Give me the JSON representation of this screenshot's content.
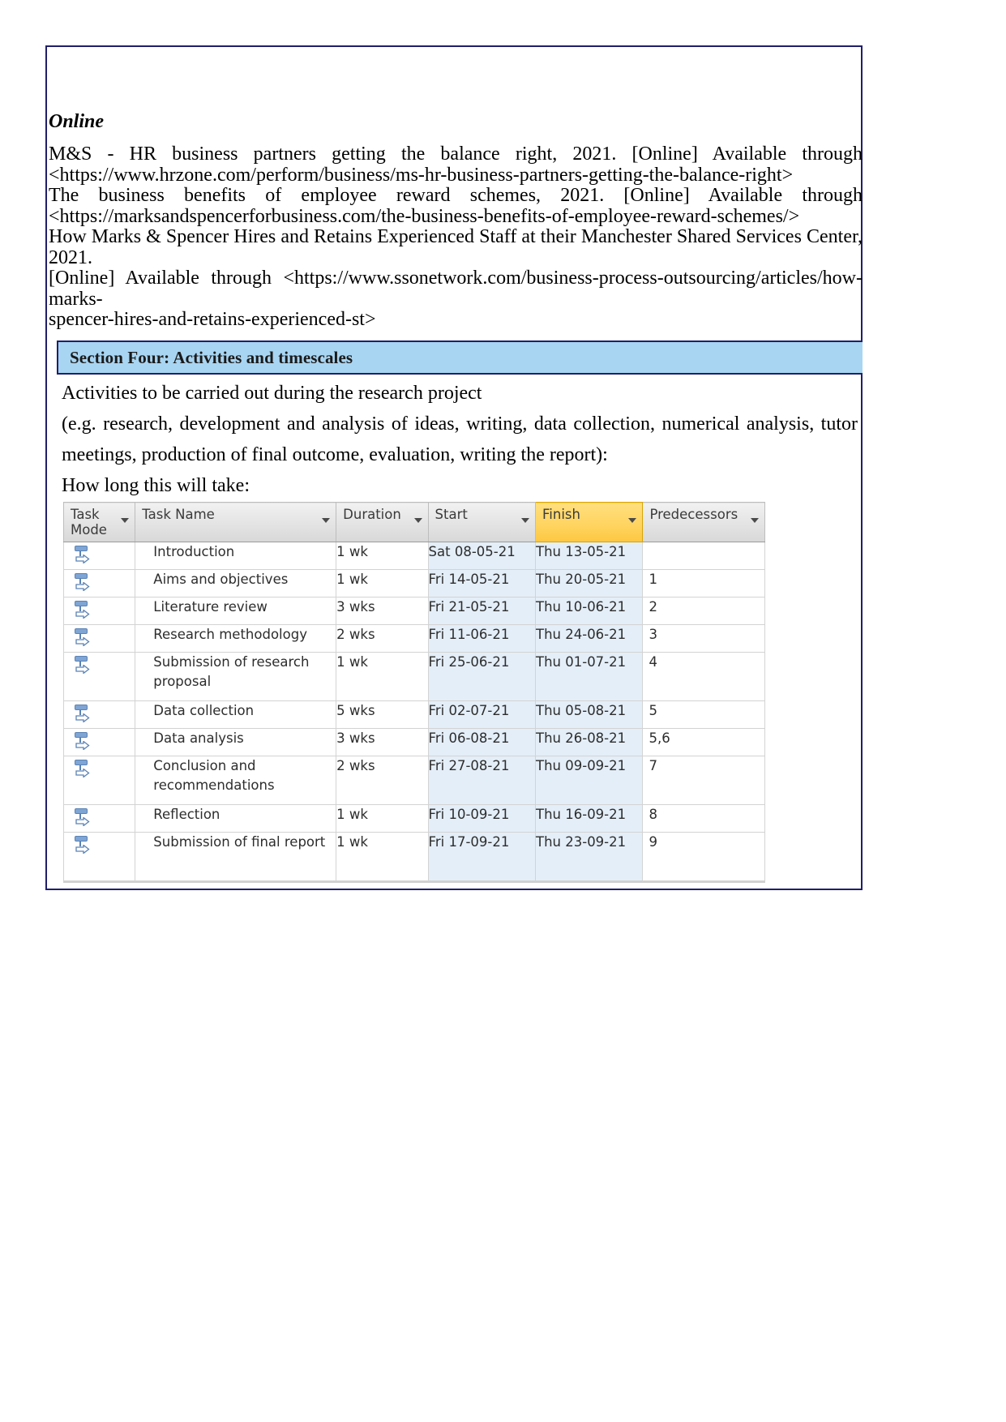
{
  "document": {
    "references": {
      "heading": "Online",
      "entries": [
        {
          "citation": "M&S - HR business partners getting the balance right, 2021. [Online] Available through",
          "url": "<https://www.hrzone.com/perform/business/ms-hr-business-partners-getting-the-balance-right>"
        },
        {
          "citation": "The business benefits of employee reward schemes, 2021. [Online] Available through",
          "url": "<https://marksandspencerforbusiness.com/the-business-benefits-of-employee-reward-schemes/>"
        },
        {
          "citation_line1": "How Marks & Spencer Hires and Retains Experienced Staff at their Manchester Shared Services Center, 2021.",
          "citation_line2": "[Online] Available through <https://www.ssonetwork.com/business-process-outsourcing/articles/how-marks-",
          "citation_line3": "spencer-hires-and-retains-experienced-st>"
        }
      ]
    },
    "section_four": {
      "band_title": "Section Four: Activities and timescales",
      "band_color": "#a8d5f2",
      "line1": "Activities to be carried out during the research project",
      "line2": "(e.g. research, development and analysis of ideas, writing, data collection, numerical analysis, tutor",
      "line3": "meetings, production of final outcome, evaluation, writing the report):",
      "line4": "How long this will take:"
    },
    "project_table": {
      "columns": [
        {
          "id": "task_mode",
          "label": "Task Mode",
          "label_line1": "Task",
          "label_line2": "Mode",
          "highlighted": false
        },
        {
          "id": "task_name",
          "label": "Task Name",
          "highlighted": false
        },
        {
          "id": "duration",
          "label": "Duration",
          "highlighted": false
        },
        {
          "id": "start",
          "label": "Start",
          "highlighted": false
        },
        {
          "id": "finish",
          "label": "Finish",
          "highlighted": true
        },
        {
          "id": "predecessors",
          "label": "Predecessors",
          "highlighted": false
        }
      ],
      "highlight_color": "#ffd35e",
      "date_cell_color": "#e4eef8",
      "mode_icon_name": "auto-scheduled-task-icon",
      "rows": [
        {
          "mode_icon": "auto-scheduled-task-icon",
          "name": "Introduction",
          "duration": "1 wk",
          "start": "Sat 08-05-21",
          "finish": "Thu 13-05-21",
          "predecessors": ""
        },
        {
          "mode_icon": "auto-scheduled-task-icon",
          "name": "Aims and objectives",
          "duration": "1 wk",
          "start": "Fri 14-05-21",
          "finish": "Thu 20-05-21",
          "predecessors": "1"
        },
        {
          "mode_icon": "auto-scheduled-task-icon",
          "name": "Literature review",
          "duration": "3 wks",
          "start": "Fri 21-05-21",
          "finish": "Thu 10-06-21",
          "predecessors": "2"
        },
        {
          "mode_icon": "auto-scheduled-task-icon",
          "name": "Research methodology",
          "duration": "2 wks",
          "start": "Fri 11-06-21",
          "finish": "Thu 24-06-21",
          "predecessors": "3"
        },
        {
          "mode_icon": "auto-scheduled-task-icon",
          "name": "Submission of research proposal",
          "duration": "1 wk",
          "start": "Fri 25-06-21",
          "finish": "Thu 01-07-21",
          "predecessors": "4"
        },
        {
          "mode_icon": "auto-scheduled-task-icon",
          "name": "Data collection",
          "duration": "5 wks",
          "start": "Fri 02-07-21",
          "finish": "Thu 05-08-21",
          "predecessors": "5"
        },
        {
          "mode_icon": "auto-scheduled-task-icon",
          "name": "Data analysis",
          "duration": "3 wks",
          "start": "Fri 06-08-21",
          "finish": "Thu 26-08-21",
          "predecessors": "5,6"
        },
        {
          "mode_icon": "auto-scheduled-task-icon",
          "name": "Conclusion and recommendations",
          "duration": "2 wks",
          "start": "Fri 27-08-21",
          "finish": "Thu 09-09-21",
          "predecessors": "7"
        },
        {
          "mode_icon": "auto-scheduled-task-icon",
          "name": "Reflection",
          "duration": "1 wk",
          "start": "Fri 10-09-21",
          "finish": "Thu 16-09-21",
          "predecessors": "8"
        },
        {
          "mode_icon": "auto-scheduled-task-icon",
          "name": "Submission of final report",
          "duration": "1 wk",
          "start": "Fri 17-09-21",
          "finish": "Thu 23-09-21",
          "predecessors": "9"
        }
      ]
    }
  }
}
